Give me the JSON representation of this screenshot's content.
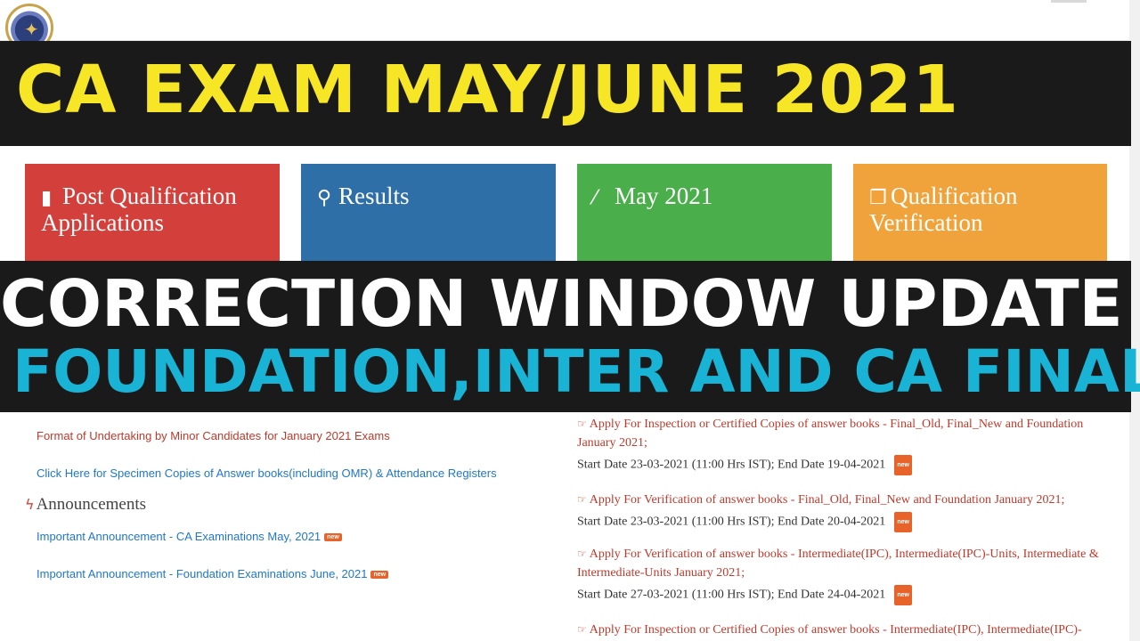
{
  "header": {
    "logo_icon": "icai-logo-icon"
  },
  "banner": {
    "headline": "CA EXAM MAY/JUNE 2021",
    "line1": "CORRECTION WINDOW UPDATE",
    "line2": "FOUNDATION,INTER AND CA FINAL"
  },
  "tiles": [
    {
      "label": "Post Qualification Applications",
      "icon": "book-icon",
      "color": "#d33f3a"
    },
    {
      "label": "Results",
      "icon": "search-icon",
      "color": "#2f6fa8"
    },
    {
      "label": "May 2021",
      "icon": "magic-wand-icon",
      "color": "#4aae4a"
    },
    {
      "label": "Qualification Verification",
      "icon": "copy-icon",
      "color": "#f0a33a"
    }
  ],
  "left_links": {
    "undertaking": "Format of Undertaking by Minor Candidates for January 2021 Exams",
    "specimen": "Click Here for Specimen Copies of Answer books(including OMR) & Attendance Registers"
  },
  "announcements": {
    "title": "Announcements",
    "items": [
      "Important Announcement - CA Examinations May, 2021",
      "Important Announcement - Foundation Examinations June, 2021"
    ],
    "new_badge": "new"
  },
  "notices": [
    {
      "title": "Apply For Inspection or Certified Copies of answer books - Final_Old, Final_New and Foundation January 2021;",
      "dates": "Start Date 23-03-2021 (11:00 Hrs IST); End Date 19-04-2021"
    },
    {
      "title": "Apply For Verification of answer books - Final_Old, Final_New and Foundation January 2021;",
      "dates": "Start Date 23-03-2021 (11:00 Hrs IST); End Date 20-04-2021"
    },
    {
      "title": "Apply For Verification of answer books - Intermediate(IPC), Intermediate(IPC)-Units, Intermediate & Intermediate-Units January 2021;",
      "dates": "Start Date 27-03-2021 (11:00 Hrs IST); End Date 24-04-2021"
    },
    {
      "title": "Apply For Inspection or Certified Copies of answer books - Intermediate(IPC), Intermediate(IPC)-Units,",
      "dates": ""
    }
  ],
  "colors": {
    "band": "#1a1a1a",
    "headline_yellow": "#f7e626",
    "foundation_cyan": "#19b3d6",
    "link_red": "#c0392b",
    "link_blue": "#1f77c9",
    "badge_orange": "#e8632a"
  }
}
